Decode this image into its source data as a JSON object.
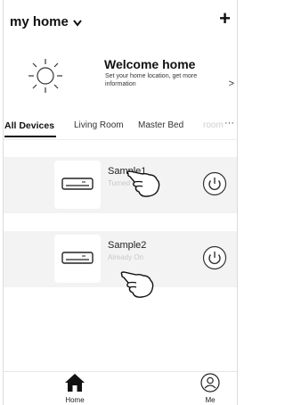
{
  "header": {
    "home_name": "my home"
  },
  "welcome": {
    "title": "Welcome home",
    "subtitle": "Set your home location, get more information"
  },
  "tabs": {
    "items": [
      "All Devices",
      "Living Room",
      "Master Bed"
    ],
    "overflow_fragment": "room",
    "active": "All Devices"
  },
  "devices": [
    {
      "name": "Sample1",
      "status": "Turned off"
    },
    {
      "name": "Sample2",
      "status": "Already On"
    }
  ],
  "bottom_nav": {
    "home": "Home",
    "me": "Me"
  },
  "icons": {
    "home_dropdown": "chevron-down-icon",
    "add": "plus-icon",
    "welcome": "sun-icon",
    "arrow": "chevron-right-icon",
    "more": "ellipsis-icon",
    "device": "air-conditioner-icon",
    "power": "power-icon",
    "hint": "hand-pointer-icon",
    "nav_home": "house-icon",
    "nav_me": "user-icon"
  },
  "colors": {
    "accent": "#111111",
    "card_bg": "#f3f3f3",
    "muted": "#c8c8c8"
  }
}
